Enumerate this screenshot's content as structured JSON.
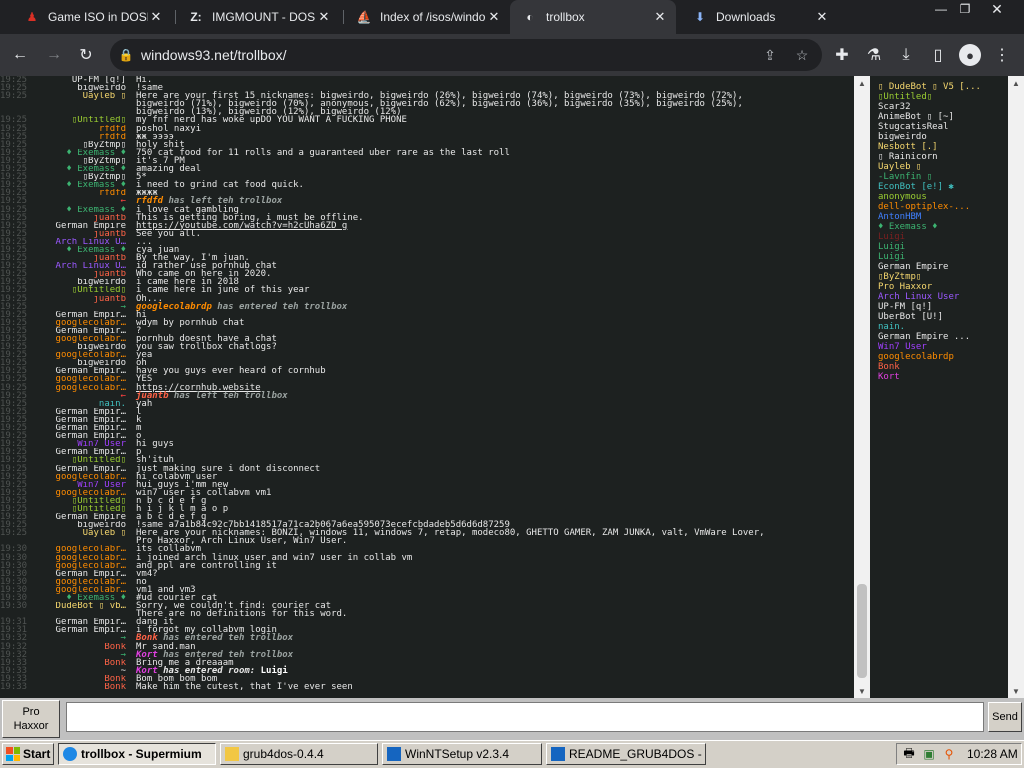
{
  "browser": {
    "tabs": [
      {
        "title": "Game ISO in DOSBo",
        "icon": "dosbox-icon",
        "fav": "♟",
        "fav_color": "#d93025"
      },
      {
        "title": "IMGMOUNT - DOSB",
        "icon": "z-icon",
        "fav": "Z:",
        "fav_color": "#e8eaed"
      },
      {
        "title": "Index of /isos/windo",
        "icon": "ship-icon",
        "fav": "⛵",
        "fav_color": "#9aa0a6"
      },
      {
        "title": "trollbox",
        "icon": "trollbox-icon",
        "fav": "◐",
        "fav_color": "#e8eaed"
      },
      {
        "title": "Downloads",
        "icon": "download-icon",
        "fav": "⬇",
        "fav_color": "#8ab4f8"
      }
    ],
    "url": "windows93.net/trollbox/"
  },
  "chat": [
    {
      "ts": "19:25",
      "nick": "UP-FM [q!]",
      "color": "#e8e8e8",
      "msg": "Hi."
    },
    {
      "ts": "19:25",
      "nick": "bigweirdo",
      "color": "#e8e8e8",
      "msg": "!same"
    },
    {
      "ts": "19:25",
      "nick": "Uayleb ▯",
      "color": "#f5d76e",
      "msg": "Here are your first 15 nicknames: bigweirdo, bigweirdo (26%), bigweirdo (74%), bigweirdo (73%), bigweirdo (72%),"
    },
    {
      "ts": "",
      "nick": "",
      "color": "#e8e8e8",
      "msg": "bigweirdo (71%), bigweirdo (70%), anonymous, bigweirdo (62%), bigweirdo (36%), bigweirdo (35%), bigweirdo (25%),"
    },
    {
      "ts": "",
      "nick": "",
      "color": "#e8e8e8",
      "msg": "bigweirdo (13%), bigweirdo (12%), bigweirdo (12%)"
    },
    {
      "ts": "19:25",
      "nick": "▯Untitled▯",
      "color": "#9acd32",
      "msg": "my fnf nerd has woke upDO YOU WANT A FUCKING PHONE"
    },
    {
      "ts": "19:25",
      "nick": "rfdfd",
      "color": "#ff8c00",
      "msg": "poshol naxyi"
    },
    {
      "ts": "19:25",
      "nick": "rfdfd",
      "color": "#ff8c00",
      "msg": "жж ээээ"
    },
    {
      "ts": "19:25",
      "nick": "▯ByZtmp▯",
      "color": "#e8e8e8",
      "msg": "holy shit"
    },
    {
      "ts": "19:25",
      "nick": "♦ Exemass ♦",
      "color": "#3cb371",
      "msg": "750 cat food for 11 rolls and a guaranteed uber rare as the last roll"
    },
    {
      "ts": "19:25",
      "nick": "▯ByZtmp▯",
      "color": "#e8e8e8",
      "msg": "it's 7 PM"
    },
    {
      "ts": "19:25",
      "nick": "♦ Exemass ♦",
      "color": "#3cb371",
      "msg": "amazing deal"
    },
    {
      "ts": "19:25",
      "nick": "▯ByZtmp▯",
      "color": "#e8e8e8",
      "msg": "5*"
    },
    {
      "ts": "19:25",
      "nick": "♦ Exemass ♦",
      "color": "#3cb371",
      "msg": "i need to grind cat food quick."
    },
    {
      "ts": "19:25",
      "nick": "rfdfd",
      "color": "#ff8c00",
      "msg": "жжжж"
    },
    {
      "ts": "19:25",
      "nick": "←",
      "color": "#ff4040",
      "sys": true,
      "sn": "rfdfd",
      "sncolor": "#ff8c00",
      "msg": " has left teh trollbox"
    },
    {
      "ts": "19:25",
      "nick": "♦ Exemass ♦",
      "color": "#3cb371",
      "msg": "i love cat gambling"
    },
    {
      "ts": "19:25",
      "nick": "juantb",
      "color": "#ff6347",
      "msg": "This is getting boring, i must be offline."
    },
    {
      "ts": "19:25",
      "nick": "German Empire",
      "color": "#e8e8e8",
      "msg": "https://youtube.com/watch?v=h2cUha6ZD_g",
      "link": true
    },
    {
      "ts": "19:25",
      "nick": "juantb",
      "color": "#ff6347",
      "msg": "See you all."
    },
    {
      "ts": "19:25",
      "nick": "Arch Linux U…",
      "color": "#9b59ff",
      "msg": "..."
    },
    {
      "ts": "19:25",
      "nick": "♦ Exemass ♦",
      "color": "#3cb371",
      "msg": "cya juan"
    },
    {
      "ts": "19:25",
      "nick": "juantb",
      "color": "#ff6347",
      "msg": "By the way, I'm juan."
    },
    {
      "ts": "19:25",
      "nick": "Arch Linux U…",
      "color": "#9b59ff",
      "msg": "id rather use pornhub chat"
    },
    {
      "ts": "19:25",
      "nick": "juantb",
      "color": "#ff6347",
      "msg": "Who came on here in 2020."
    },
    {
      "ts": "19:25",
      "nick": "bigweirdo",
      "color": "#e8e8e8",
      "msg": "i came here in 2018"
    },
    {
      "ts": "19:25",
      "nick": "▯Untitled▯",
      "color": "#9acd32",
      "msg": "i came here in june of this year"
    },
    {
      "ts": "19:25",
      "nick": "juantb",
      "color": "#ff6347",
      "msg": "Oh..."
    },
    {
      "ts": "19:25",
      "nick": "→",
      "color": "#3cb371",
      "sys": true,
      "sn": "googlecolabrdp",
      "sncolor": "#ff8c00",
      "msg": " has entered teh trollbox"
    },
    {
      "ts": "19:25",
      "nick": "German Empir…",
      "color": "#e8e8e8",
      "msg": "hi"
    },
    {
      "ts": "19:25",
      "nick": "googlecolabr…",
      "color": "#ff8c00",
      "msg": "wdym by pornhub chat"
    },
    {
      "ts": "19:25",
      "nick": "German Empir…",
      "color": "#e8e8e8",
      "msg": "?"
    },
    {
      "ts": "19:25",
      "nick": "googlecolabr…",
      "color": "#ff8c00",
      "msg": "pornhub doesnt have a chat"
    },
    {
      "ts": "19:25",
      "nick": "bigweirdo",
      "color": "#e8e8e8",
      "msg": "you saw trollbox chatlogs?"
    },
    {
      "ts": "19:25",
      "nick": "googlecolabr…",
      "color": "#ff8c00",
      "msg": "yea"
    },
    {
      "ts": "19:25",
      "nick": "bigweirdo",
      "color": "#e8e8e8",
      "msg": "oh"
    },
    {
      "ts": "19:25",
      "nick": "German Empir…",
      "color": "#e8e8e8",
      "msg": "have you guys ever heard of cornhub"
    },
    {
      "ts": "19:25",
      "nick": "googlecolabr…",
      "color": "#ff8c00",
      "msg": "YES"
    },
    {
      "ts": "19:25",
      "nick": "googlecolabr…",
      "color": "#ff8c00",
      "msg": "https://cornhub.website",
      "link": true
    },
    {
      "ts": "19:25",
      "nick": "←",
      "color": "#ff4040",
      "sys": true,
      "sn": "juantb",
      "sncolor": "#ff6347",
      "msg": " has left teh trollbox"
    },
    {
      "ts": "19:25",
      "nick": "nain.",
      "color": "#40c0c0",
      "msg": "yah"
    },
    {
      "ts": "19:25",
      "nick": "German Empir…",
      "color": "#e8e8e8",
      "msg": "l"
    },
    {
      "ts": "19:25",
      "nick": "German Empir…",
      "color": "#e8e8e8",
      "msg": "k"
    },
    {
      "ts": "19:25",
      "nick": "German Empir…",
      "color": "#e8e8e8",
      "msg": "m"
    },
    {
      "ts": "19:25",
      "nick": "German Empir…",
      "color": "#e8e8e8",
      "msg": "o"
    },
    {
      "ts": "19:25",
      "nick": "Win7 User",
      "color": "#a040ff",
      "msg": "hi guys"
    },
    {
      "ts": "19:25",
      "nick": "German Empir…",
      "color": "#e8e8e8",
      "msg": "p"
    },
    {
      "ts": "19:25",
      "nick": "▯Untitled▯",
      "color": "#9acd32",
      "msg": "sh'ituh"
    },
    {
      "ts": "19:25",
      "nick": "German Empir…",
      "color": "#e8e8e8",
      "msg": "just making sure i dont disconnect"
    },
    {
      "ts": "19:25",
      "nick": "googlecolabr…",
      "color": "#ff8c00",
      "msg": "hi colabvm user"
    },
    {
      "ts": "19:25",
      "nick": "Win7 User",
      "color": "#a040ff",
      "msg": "hui guys i'mm new"
    },
    {
      "ts": "19:25",
      "nick": "googlecolabr…",
      "color": "#ff8c00",
      "msg": "win7 user is collabvm vm1"
    },
    {
      "ts": "19:25",
      "nick": "▯Untitled▯",
      "color": "#9acd32",
      "msg": "n b c d e f g"
    },
    {
      "ts": "19:25",
      "nick": "▯Untitled▯",
      "color": "#9acd32",
      "msg": "h i j k l m a o p"
    },
    {
      "ts": "19:25",
      "nick": "German Empire",
      "color": "#e8e8e8",
      "msg": "a b c d e f g"
    },
    {
      "ts": "19:25",
      "nick": "bigweirdo",
      "color": "#e8e8e8",
      "msg": "!same a7a1b84c92c7bb1418517a71ca2b067a6ea595073ecefcbdadeb5d6d6d87259"
    },
    {
      "ts": "19:25",
      "nick": "Uayleb ▯",
      "color": "#f5d76e",
      "msg": "Here are your nicknames: BONZI, windows 11, windows 7, retap, modeco80, GHETTO GAMER, ZAM JUNKA, valt, VmWare Lover,"
    },
    {
      "ts": "",
      "nick": "",
      "color": "#e8e8e8",
      "msg": "Pro Haxxor, Arch Linux User, Win7 User."
    },
    {
      "ts": "19:30",
      "nick": "googlecolabr…",
      "color": "#ff8c00",
      "msg": "its collabvm"
    },
    {
      "ts": "19:30",
      "nick": "googlecolabr…",
      "color": "#ff8c00",
      "msg": "i joined arch linux user and win7 user in collab vm"
    },
    {
      "ts": "19:30",
      "nick": "googlecolabr…",
      "color": "#ff8c00",
      "msg": "and ppl are controlling it"
    },
    {
      "ts": "19:30",
      "nick": "German Empir…",
      "color": "#e8e8e8",
      "msg": "vm4?"
    },
    {
      "ts": "19:30",
      "nick": "googlecolabr…",
      "color": "#ff8c00",
      "msg": "no"
    },
    {
      "ts": "19:30",
      "nick": "googlecolabr…",
      "color": "#ff8c00",
      "msg": "vm1 and vm3"
    },
    {
      "ts": "19:30",
      "nick": "♦ Exemass ♦",
      "color": "#3cb371",
      "msg": "#ud courier cat"
    },
    {
      "ts": "19:30",
      "nick": "DudeBot ▯ vb…",
      "color": "#f5d76e",
      "msg": "Sorry, we couldn't find: courier cat"
    },
    {
      "ts": "",
      "nick": "",
      "color": "#e8e8e8",
      "msg": "There are no definitions for this word."
    },
    {
      "ts": "19:31",
      "nick": "German Empir…",
      "color": "#e8e8e8",
      "msg": "dang it"
    },
    {
      "ts": "19:31",
      "nick": "German Empir…",
      "color": "#e8e8e8",
      "msg": "i forgot my collabvm login"
    },
    {
      "ts": "19:32",
      "nick": "→",
      "color": "#3cb371",
      "sys": true,
      "sn": "Bonk",
      "sncolor": "#ff6347",
      "msg": " has entered teh trollbox"
    },
    {
      "ts": "19:32",
      "nick": "Bonk",
      "color": "#ff6347",
      "msg": "Mr sand.man"
    },
    {
      "ts": "19:32",
      "nick": "→",
      "color": "#3cb371",
      "sys": true,
      "sn": "Kort",
      "sncolor": "#e040e0",
      "msg": " has entered teh trollbox"
    },
    {
      "ts": "19:33",
      "nick": "Bonk",
      "color": "#ff6347",
      "msg": "Bring me a dreaaam"
    },
    {
      "ts": "19:33",
      "nick": "~",
      "color": "#e8e8e8",
      "sys": true,
      "sn": "Kort",
      "sncolor": "#e040e0",
      "msg": " has entered room: ",
      "bold": "Luigi"
    },
    {
      "ts": "19:33",
      "nick": "Bonk",
      "color": "#ff6347",
      "msg": "Bom bom bom bom"
    },
    {
      "ts": "19:33",
      "nick": "Bonk",
      "color": "#ff6347",
      "msg": "Make him the cutest, that I've ever seen"
    }
  ],
  "users": [
    {
      "name": "▯ DudeBot ▯ V5 [...",
      "color": "#f5d76e"
    },
    {
      "name": "▯Untitled▯",
      "color": "#9acd32"
    },
    {
      "name": "Scar32",
      "color": "#e8e8e8"
    },
    {
      "name": "AnimeBot ▯ [~]",
      "color": "#e8e8e8"
    },
    {
      "name": "StugcatisReal",
      "color": "#e8e8e8"
    },
    {
      "name": "bigweirdo",
      "color": "#e8e8e8"
    },
    {
      "name": "Nesbott [.]",
      "color": "#f5d76e"
    },
    {
      "name": "▯ Rainicorn",
      "color": "#e8e8e8"
    },
    {
      "name": "Uayleb ▯",
      "color": "#f5d76e"
    },
    {
      "name": "-Lavnfin ▯",
      "color": "#3cb371"
    },
    {
      "name": "EconBot [e!] ✱",
      "color": "#40c0c0"
    },
    {
      "name": "anonymous",
      "color": "#9acd32"
    },
    {
      "name": "dell-optiplex-...",
      "color": "#ff8c00"
    },
    {
      "name": "AntonHBM",
      "color": "#4080ff"
    },
    {
      "name": "♦ Exemass ♦",
      "color": "#3cb371"
    },
    {
      "name": "Luigi",
      "color": "#7a2020"
    },
    {
      "name": "Luigi",
      "color": "#3cb371"
    },
    {
      "name": "Luigi",
      "color": "#3cb371"
    },
    {
      "name": "German Empire",
      "color": "#e8e8e8"
    },
    {
      "name": "▯ByZtmp▯",
      "color": "#f5d76e"
    },
    {
      "name": "Pro Haxxor",
      "color": "#f5d76e"
    },
    {
      "name": "Arch Linux User",
      "color": "#9b59ff"
    },
    {
      "name": "UP-FM [q!]",
      "color": "#e8e8e8"
    },
    {
      "name": "UberBot [U!]",
      "color": "#e8e8e8"
    },
    {
      "name": "nain.",
      "color": "#40c0c0"
    },
    {
      "name": "German Empire ...",
      "color": "#e8e8e8"
    },
    {
      "name": "Win7 User",
      "color": "#a040ff"
    },
    {
      "name": "googlecolabrdp",
      "color": "#ff8c00"
    },
    {
      "name": "Bonk",
      "color": "#ff6347"
    },
    {
      "name": "Kort",
      "color": "#e040e0"
    }
  ],
  "input": {
    "nick_label": "Pro\nHaxxor",
    "send_label": "Send",
    "value": ""
  },
  "taskbar": {
    "start_label": "Start",
    "items": [
      {
        "label": "trollbox - Supermium",
        "icon_color": "#1e88e5"
      },
      {
        "label": "grub4dos-0.4.4",
        "icon_color": "#f2c744"
      },
      {
        "label": "WinNTSetup v2.3.4",
        "icon_color": "#1565c0"
      },
      {
        "label": "README_GRUB4DOS - ...",
        "icon_color": "#1565c0"
      }
    ],
    "clock": "10:28 AM"
  }
}
